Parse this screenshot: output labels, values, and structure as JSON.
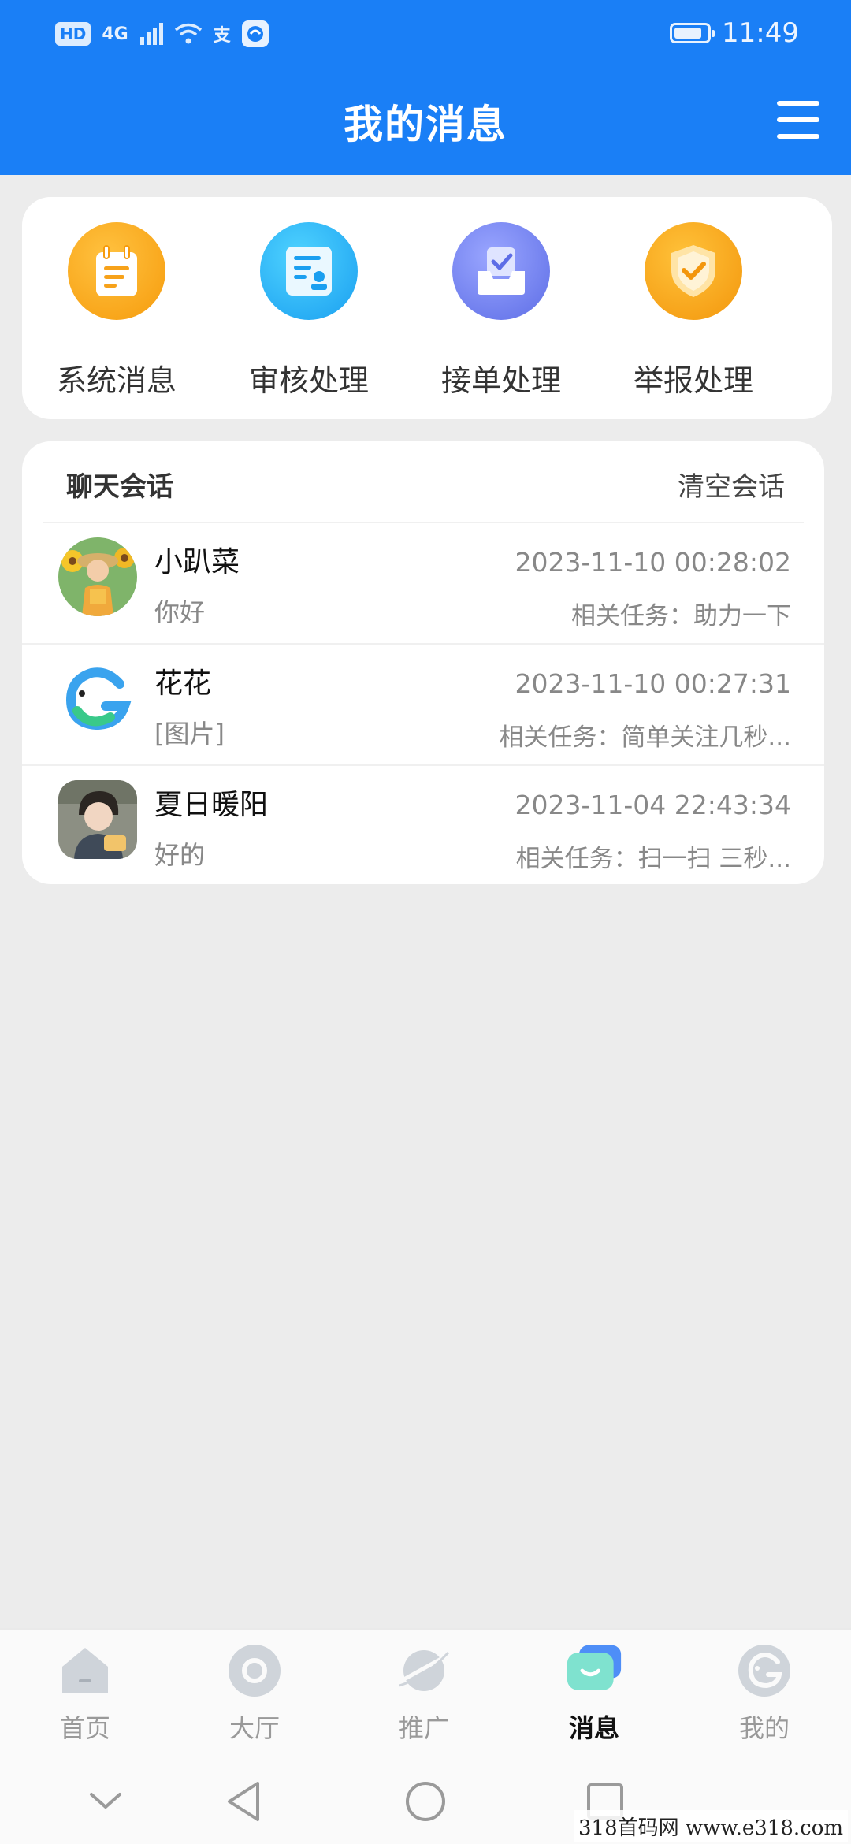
{
  "status_bar": {
    "hd": "HD",
    "network": "4G",
    "pay_icon_text": "支",
    "time": "11:49",
    "battery_level": 0.85
  },
  "header": {
    "title": "我的消息"
  },
  "shortcuts": [
    {
      "label": "系统消息",
      "icon": "notepad-icon",
      "color": "#f9a41a"
    },
    {
      "label": "审核处理",
      "icon": "review-document-icon",
      "color": "#21aef0"
    },
    {
      "label": "接单处理",
      "icon": "inbox-check-icon",
      "color": "#6b7cf0"
    },
    {
      "label": "举报处理",
      "icon": "shield-check-icon",
      "color": "#f8a11b"
    }
  ],
  "chat": {
    "title": "聊天会话",
    "clear_label": "清空会话",
    "rows": [
      {
        "name": "小趴菜",
        "preview": "你好",
        "time": "2023-11-10 00:28:02",
        "task": "相关任务：助力一下"
      },
      {
        "name": "花花",
        "preview": "[图片]",
        "time": "2023-11-10 00:27:31",
        "task": "相关任务：简单关注几秒..."
      },
      {
        "name": "夏日暖阳",
        "preview": "好的",
        "time": "2023-11-04 22:43:34",
        "task": "相关任务：扫一扫 三秒..."
      }
    ]
  },
  "bottom_nav": [
    {
      "label": "首页",
      "icon": "home-icon"
    },
    {
      "label": "大厅",
      "icon": "hall-icon"
    },
    {
      "label": "推广",
      "icon": "promote-planet-icon"
    },
    {
      "label": "消息",
      "icon": "message-bubble-icon",
      "active": true
    },
    {
      "label": "我的",
      "icon": "profile-bird-icon"
    }
  ],
  "watermark": "318首码网  www.e318.com",
  "colors": {
    "primary": "#1a7ff6",
    "background": "#ececec"
  }
}
